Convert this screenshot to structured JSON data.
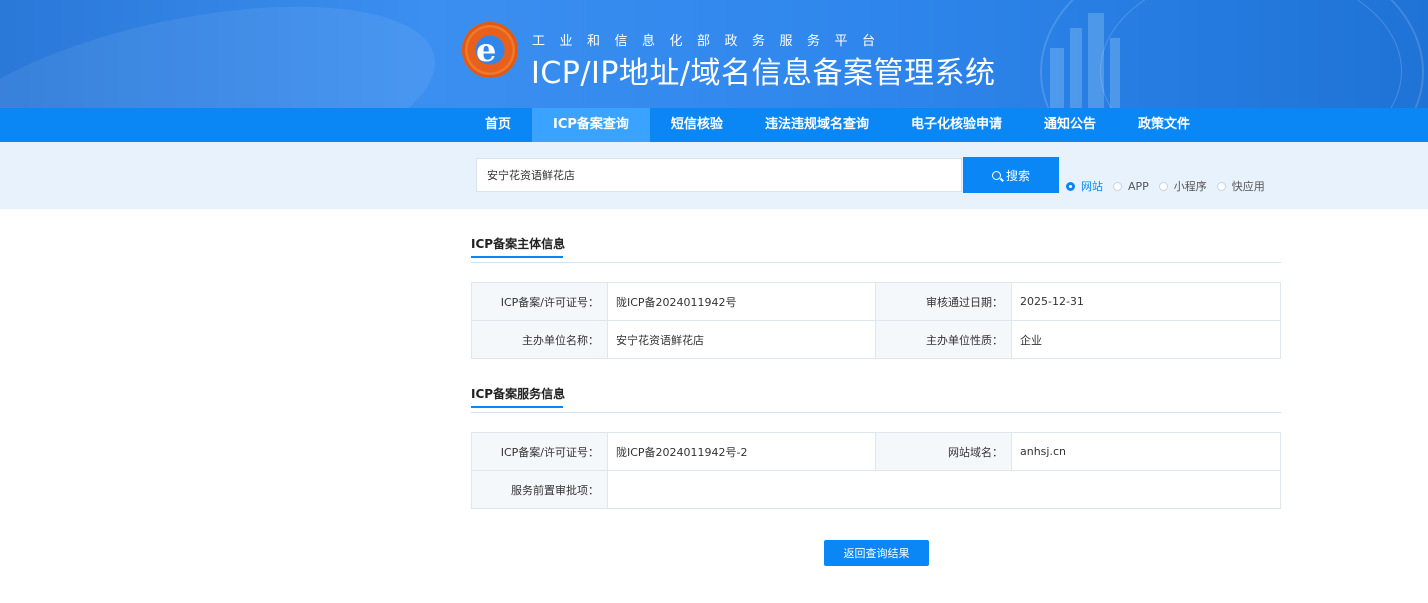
{
  "header": {
    "subtitle": "工业和信息化部政务服务平台",
    "title": "ICP/IP地址/域名信息备案管理系统"
  },
  "nav": {
    "items": [
      {
        "label": "首页"
      },
      {
        "label": "ICP备案查询"
      },
      {
        "label": "短信核验"
      },
      {
        "label": "违法违规域名查询"
      },
      {
        "label": "电子化核验申请"
      },
      {
        "label": "通知公告"
      },
      {
        "label": "政策文件"
      }
    ],
    "active_index": 1
  },
  "search": {
    "value": "安宁花资语鲜花店",
    "button_label": "搜索",
    "options": [
      {
        "label": "网站",
        "checked": true
      },
      {
        "label": "APP",
        "checked": false
      },
      {
        "label": "小程序",
        "checked": false
      },
      {
        "label": "快应用",
        "checked": false
      }
    ]
  },
  "subject_info": {
    "title": "ICP备案主体信息",
    "rows": [
      {
        "label1": "ICP备案/许可证号：",
        "value1": "陇ICP备2024011942号",
        "label2": "审核通过日期：",
        "value2": "2025-12-31"
      },
      {
        "label1": "主办单位名称：",
        "value1": "安宁花资语鲜花店",
        "label2": "主办单位性质：",
        "value2": "企业"
      }
    ]
  },
  "service_info": {
    "title": "ICP备案服务信息",
    "row1": {
      "label1": "ICP备案/许可证号：",
      "value1": "陇ICP备2024011942号-2",
      "label2": "网站域名：",
      "value2": "anhsj.cn"
    },
    "row2": {
      "label1": "服务前置审批项：",
      "value1": ""
    }
  },
  "back_button": "返回查询结果",
  "colors": {
    "primary": "#0b86f5",
    "nav_active": "#3aa3ff",
    "search_strip": "#e8f2fc"
  }
}
